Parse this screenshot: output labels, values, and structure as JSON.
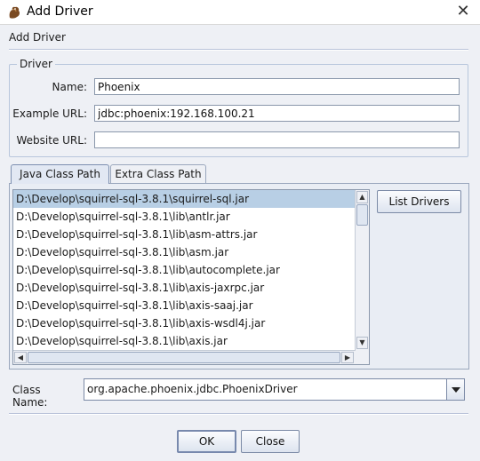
{
  "window": {
    "title": "Add Driver",
    "close_glyph": "✕",
    "icon": "squirrel-icon"
  },
  "header": {
    "label": "Add Driver"
  },
  "driver": {
    "group_title": "Driver",
    "name_label": "Name:",
    "name_value": "Phoenix",
    "example_url_label": "Example URL:",
    "example_url_value": "jdbc:phoenix:192.168.100.21",
    "website_url_label": "Website URL:",
    "website_url_value": ""
  },
  "tabs": [
    {
      "label": "Java Class Path",
      "active": true
    },
    {
      "label": "Extra Class Path",
      "active": false
    }
  ],
  "classpath": {
    "items": [
      "D:\\Develop\\squirrel-sql-3.8.1\\squirrel-sql.jar",
      "D:\\Develop\\squirrel-sql-3.8.1\\lib\\antlr.jar",
      "D:\\Develop\\squirrel-sql-3.8.1\\lib\\asm-attrs.jar",
      "D:\\Develop\\squirrel-sql-3.8.1\\lib\\asm.jar",
      "D:\\Develop\\squirrel-sql-3.8.1\\lib\\autocomplete.jar",
      "D:\\Develop\\squirrel-sql-3.8.1\\lib\\axis-jaxrpc.jar",
      "D:\\Develop\\squirrel-sql-3.8.1\\lib\\axis-saaj.jar",
      "D:\\Develop\\squirrel-sql-3.8.1\\lib\\axis-wsdl4j.jar",
      "D:\\Develop\\squirrel-sql-3.8.1\\lib\\axis.jar"
    ],
    "selected_index": 0,
    "list_drivers_label": "List Drivers"
  },
  "class_name": {
    "label": "Class Name:",
    "value": "org.apache.phoenix.jdbc.PhoenixDriver"
  },
  "buttons": {
    "ok_label": "OK",
    "close_label": "Close"
  },
  "colors": {
    "selection": "#b8cfe5",
    "background": "#eef0f5",
    "border": "#8a97ab"
  }
}
